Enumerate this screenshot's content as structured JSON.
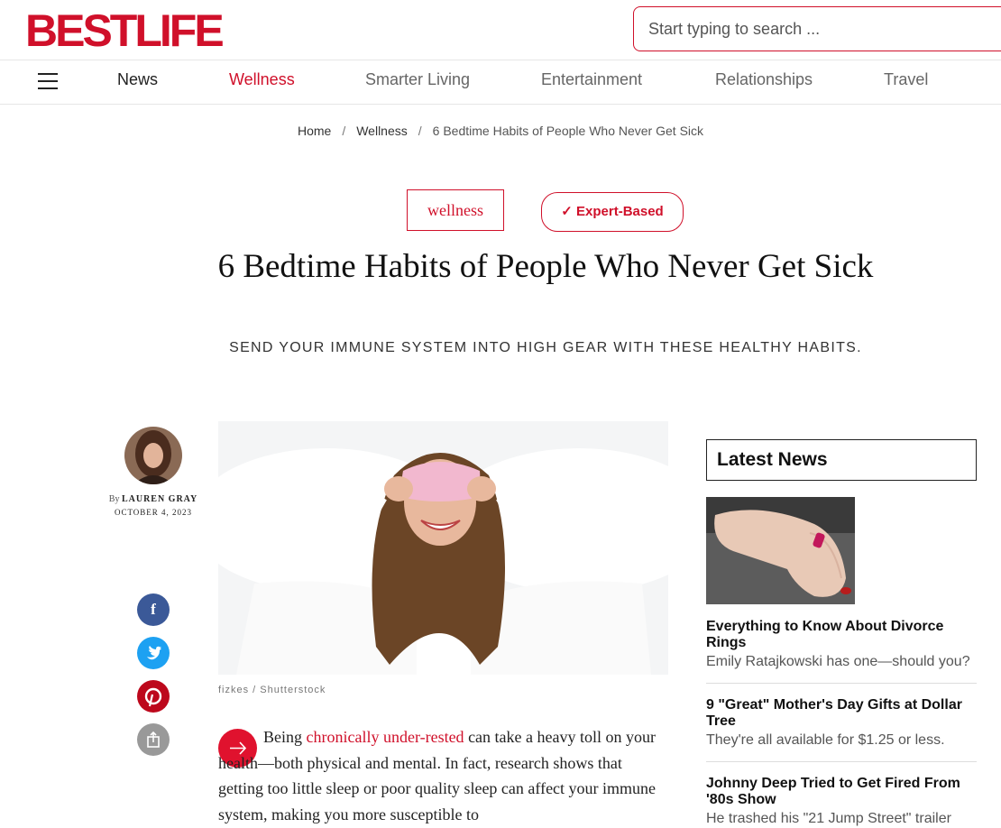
{
  "header": {
    "logo": "BESTLIFE",
    "search_placeholder": "Start typing to search ..."
  },
  "nav": {
    "items": [
      "News",
      "Wellness",
      "Smarter Living",
      "Entertainment",
      "Relationships",
      "Travel"
    ],
    "active": "Wellness"
  },
  "breadcrumb": {
    "home": "Home",
    "section": "Wellness",
    "current": "6 Bedtime Habits of People Who Never Get Sick"
  },
  "article": {
    "tag": "wellness",
    "badge": "Expert-Based",
    "badge_icon": "check-icon",
    "title": "6 Bedtime Habits of People Who Never Get Sick",
    "subtitle": "SEND YOUR IMMUNE SYSTEM INTO HIGH GEAR WITH THESE HEALTHY HABITS.",
    "author_prefix": "By",
    "author": "LAUREN GRAY",
    "date": "OCTOBER 4, 2023",
    "image_credit": "fizkes / Shutterstock",
    "body_start": "Being ",
    "body_link": "chronically under-rested",
    "body_rest": " can take a heavy toll on your health—both physical and mental. In fact, research shows that getting too little sleep or poor quality sleep can affect your immune system, making you more susceptible to"
  },
  "share": {
    "facebook": "f",
    "twitter": "twitter-icon",
    "pinterest": "pinterest-icon",
    "share": "share-icon"
  },
  "sidebar": {
    "heading": "Latest News",
    "items": [
      {
        "title": "Everything to Know About Divorce Rings",
        "desc": "Emily Ratajkowski has one—should you?"
      },
      {
        "title": "9 \"Great\" Mother's Day Gifts at Dollar Tree",
        "desc": "They're all available for $1.25 or less."
      },
      {
        "title": "Johnny Deep Tried to Get Fired From '80s Show",
        "desc": "He trashed his \"21 Jump Street\" trailer"
      }
    ]
  },
  "colors": {
    "brand": "#d0102a",
    "facebook": "#3b5998",
    "twitter": "#1da1f2",
    "pinterest": "#bd081c",
    "share": "#999999"
  }
}
